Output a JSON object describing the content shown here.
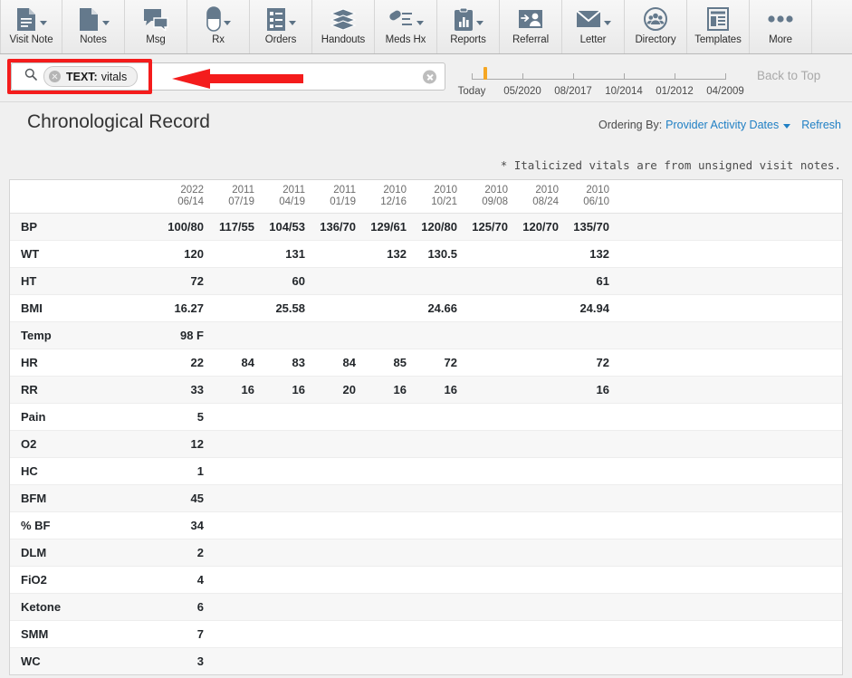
{
  "toolbar": {
    "buttons": [
      {
        "label": "Visit Note",
        "icon": "document-lines-icon",
        "caret": true
      },
      {
        "label": "Notes",
        "icon": "document-folded-icon",
        "caret": true
      },
      {
        "label": "Msg",
        "icon": "speech-bubbles-icon",
        "caret": false
      },
      {
        "label": "Rx",
        "icon": "pill-capsule-icon",
        "caret": true
      },
      {
        "label": "Orders",
        "icon": "checklist-icon",
        "caret": true
      },
      {
        "label": "Handouts",
        "icon": "stacked-sheets-icon",
        "caret": false
      },
      {
        "label": "Meds Hx",
        "icon": "pill-list-icon",
        "caret": true
      },
      {
        "label": "Reports",
        "icon": "clipboard-chart-icon",
        "caret": true
      },
      {
        "label": "Referral",
        "icon": "person-arrow-icon",
        "caret": false
      },
      {
        "label": "Letter",
        "icon": "envelope-icon",
        "caret": true
      },
      {
        "label": "Directory",
        "icon": "people-circle-icon",
        "caret": false
      },
      {
        "label": "Templates",
        "icon": "layout-template-icon",
        "caret": false
      },
      {
        "label": "More",
        "icon": "ellipsis-icon",
        "caret": false
      }
    ]
  },
  "search": {
    "token_key": "TEXT:",
    "token_value": "vitals",
    "placeholder": "",
    "value": ""
  },
  "timeline": {
    "labels": [
      "Today",
      "05/2020",
      "08/2017",
      "10/2014",
      "01/2012",
      "04/2009"
    ],
    "marker_color": "#f5a623",
    "back_to_top_label": "Back to Top"
  },
  "header": {
    "title": "Chronological Record",
    "ordering_prefix": "Ordering By:",
    "ordering_value": "Provider Activity Dates",
    "refresh_label": "Refresh",
    "link_color": "#1f7fc4"
  },
  "footnote": "* Italicized vitals are from unsigned visit notes.",
  "table": {
    "row_label_header": "",
    "columns": [
      {
        "year": "2022",
        "date": "06/14"
      },
      {
        "year": "2011",
        "date": "07/19"
      },
      {
        "year": "2011",
        "date": "04/19"
      },
      {
        "year": "2011",
        "date": "01/19"
      },
      {
        "year": "2010",
        "date": "12/16"
      },
      {
        "year": "2010",
        "date": "10/21"
      },
      {
        "year": "2010",
        "date": "09/08"
      },
      {
        "year": "2010",
        "date": "08/24"
      },
      {
        "year": "2010",
        "date": "06/10"
      }
    ],
    "rows": [
      {
        "label": "BP",
        "values": [
          "100/80",
          "117/55",
          "104/53",
          "136/70",
          "129/61",
          "120/80",
          "125/70",
          "120/70",
          "135/70"
        ]
      },
      {
        "label": "WT",
        "values": [
          "120",
          "",
          "131",
          "",
          "132",
          "130.5",
          "",
          "",
          "132"
        ]
      },
      {
        "label": "HT",
        "values": [
          "72",
          "",
          "60",
          "",
          "",
          "",
          "",
          "",
          "61"
        ]
      },
      {
        "label": "BMI",
        "values": [
          "16.27",
          "",
          "25.58",
          "",
          "",
          "24.66",
          "",
          "",
          "24.94"
        ]
      },
      {
        "label": "Temp",
        "values": [
          "98 F",
          "",
          "",
          "",
          "",
          "",
          "",
          "",
          ""
        ]
      },
      {
        "label": "HR",
        "values": [
          "22",
          "84",
          "83",
          "84",
          "85",
          "72",
          "",
          "",
          "72"
        ]
      },
      {
        "label": "RR",
        "values": [
          "33",
          "16",
          "16",
          "20",
          "16",
          "16",
          "",
          "",
          "16"
        ]
      },
      {
        "label": "Pain",
        "values": [
          "5",
          "",
          "",
          "",
          "",
          "",
          "",
          "",
          ""
        ]
      },
      {
        "label": "O2",
        "values": [
          "12",
          "",
          "",
          "",
          "",
          "",
          "",
          "",
          ""
        ]
      },
      {
        "label": "HC",
        "values": [
          "1",
          "",
          "",
          "",
          "",
          "",
          "",
          "",
          ""
        ]
      },
      {
        "label": "BFM",
        "values": [
          "45",
          "",
          "",
          "",
          "",
          "",
          "",
          "",
          ""
        ]
      },
      {
        "label": "% BF",
        "values": [
          "34",
          "",
          "",
          "",
          "",
          "",
          "",
          "",
          ""
        ]
      },
      {
        "label": "DLM",
        "values": [
          "2",
          "",
          "",
          "",
          "",
          "",
          "",
          "",
          ""
        ]
      },
      {
        "label": "FiO2",
        "values": [
          "4",
          "",
          "",
          "",
          "",
          "",
          "",
          "",
          ""
        ]
      },
      {
        "label": "Ketone",
        "values": [
          "6",
          "",
          "",
          "",
          "",
          "",
          "",
          "",
          ""
        ]
      },
      {
        "label": "SMM",
        "values": [
          "7",
          "",
          "",
          "",
          "",
          "",
          "",
          "",
          ""
        ]
      },
      {
        "label": "WC",
        "values": [
          "3",
          "",
          "",
          "",
          "",
          "",
          "",
          "",
          ""
        ]
      }
    ]
  },
  "annotation": {
    "box_color": "#f41c1c",
    "arrow_color": "#f41c1c"
  }
}
